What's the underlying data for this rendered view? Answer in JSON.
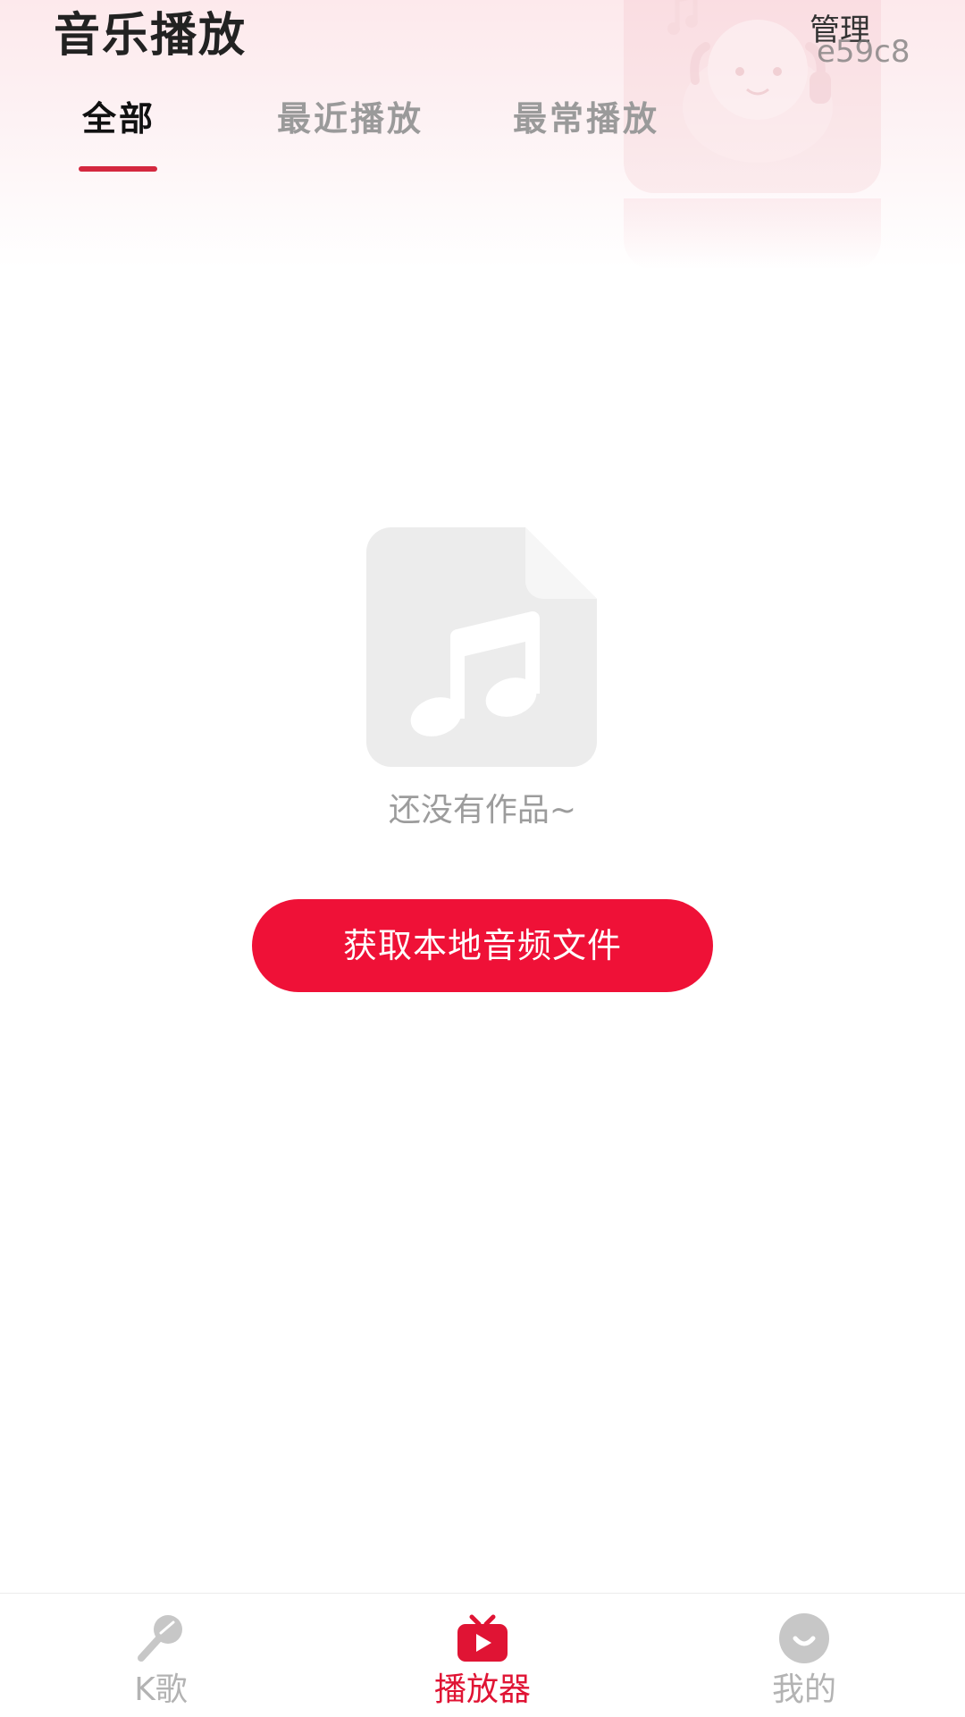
{
  "header": {
    "title": "音乐播放",
    "manage_label": "管理",
    "overlay_code": "e59c8"
  },
  "tabs": [
    {
      "label": "全部",
      "active": true
    },
    {
      "label": "最近播放",
      "active": false
    },
    {
      "label": "最常播放",
      "active": false
    }
  ],
  "empty_state": {
    "icon": "music-file-icon",
    "message": "还没有作品~",
    "action_label": "获取本地音频文件"
  },
  "bottom_nav": [
    {
      "label": "K歌",
      "icon": "microphone-icon",
      "active": false
    },
    {
      "label": "播放器",
      "icon": "tv-play-icon",
      "active": true
    },
    {
      "label": "我的",
      "icon": "smile-face-icon",
      "active": false
    }
  ],
  "colors": {
    "accent": "#ef1137",
    "active_tab_indicator": "#d4283f",
    "inactive_text": "#9a9a9a"
  }
}
